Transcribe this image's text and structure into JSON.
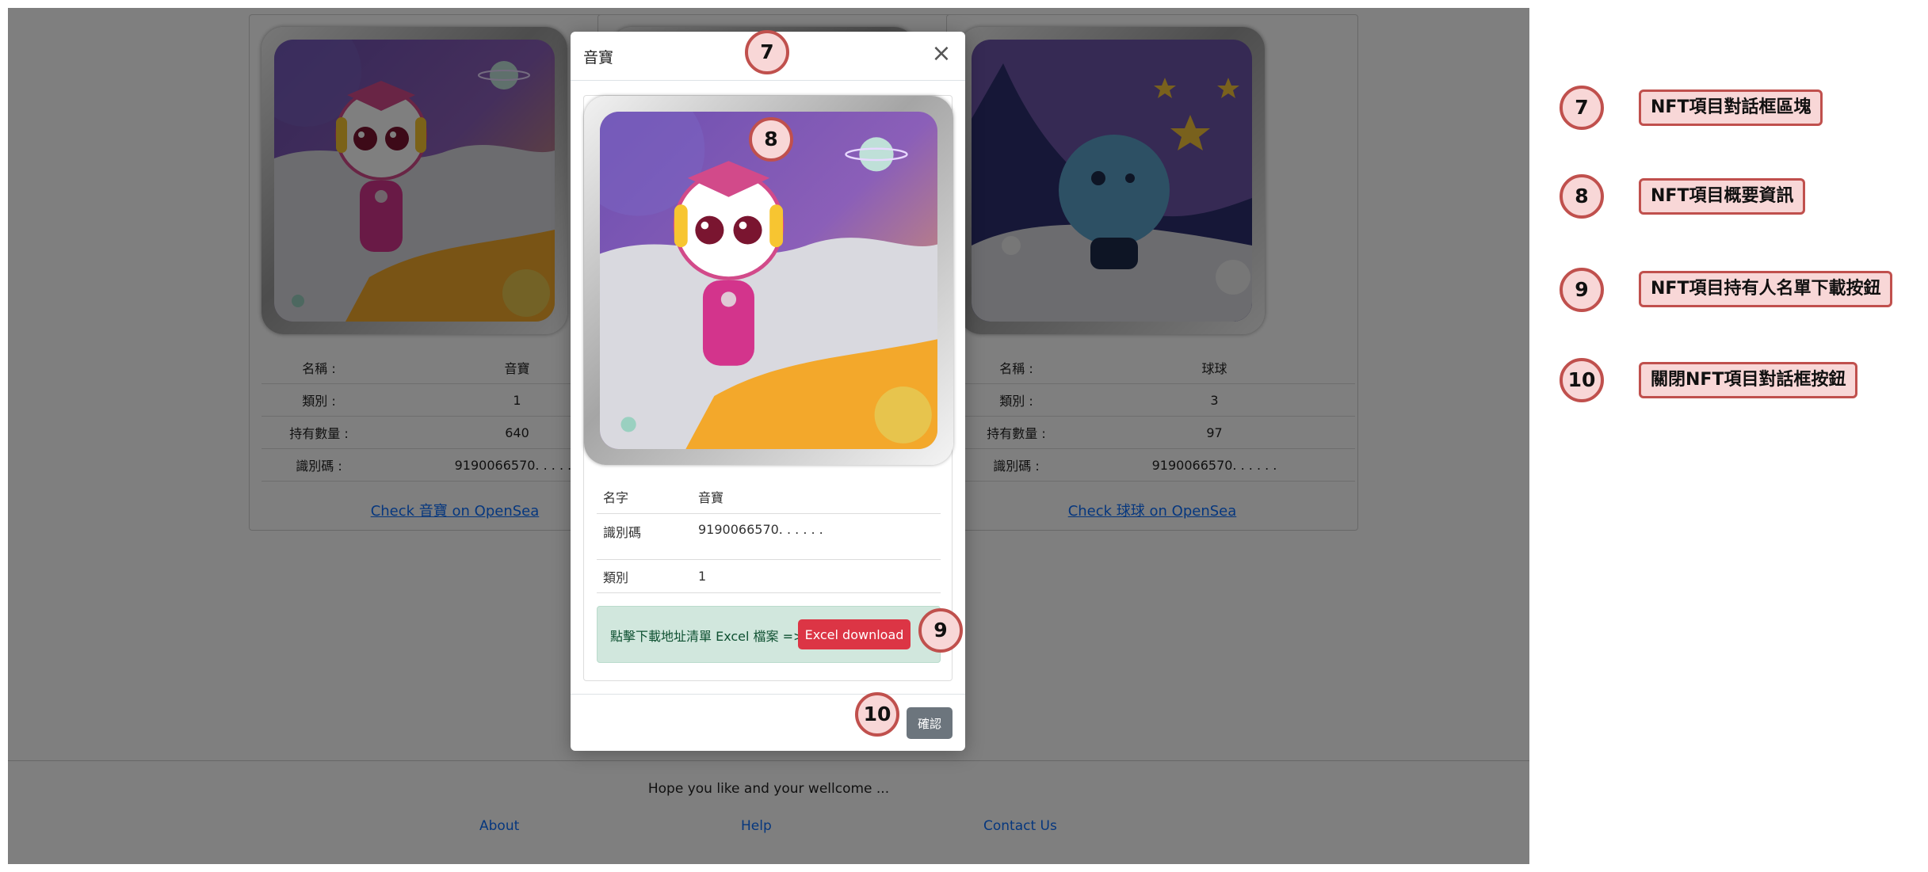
{
  "colors": {
    "accent": "#0d6efd",
    "danger": "#dc3545",
    "secondary": "#6c757d",
    "success_bg": "#d1e7dd",
    "annotation": "#c0504d"
  },
  "cards": [
    {
      "rows": [
        {
          "key": "名稱 :",
          "value": "音寶"
        },
        {
          "key": "類別 :",
          "value": "1"
        },
        {
          "key": "持有數量 :",
          "value": "640"
        },
        {
          "key": "識別碼 :",
          "value": "9190066570. . . . . ."
        }
      ],
      "link": "Check 音寶 on OpenSea"
    },
    {
      "rows": [
        {
          "key": "名稱 :",
          "value": ""
        },
        {
          "key": "類別 :",
          "value": ""
        },
        {
          "key": "持有數量 :",
          "value": ""
        },
        {
          "key": "識別碼 :",
          "value": ""
        }
      ],
      "link": ""
    },
    {
      "rows": [
        {
          "key": "名稱 :",
          "value": "球球"
        },
        {
          "key": "類別 :",
          "value": "3"
        },
        {
          "key": "持有數量 :",
          "value": "97"
        },
        {
          "key": "識別碼 :",
          "value": "9190066570. . . . . ."
        }
      ],
      "link": "Check 球球 on OpenSea"
    }
  ],
  "footer": {
    "text": "Hope you like and your wellcome ...",
    "links": [
      "About",
      "Help",
      "Contact Us"
    ]
  },
  "modal": {
    "title": "音寶",
    "close_icon": "close-icon",
    "info": [
      {
        "key": "名字",
        "value": "音寶"
      },
      {
        "key": "識別碼",
        "value": "9190066570. . . . . ."
      },
      {
        "key": "類別",
        "value": "1"
      }
    ],
    "alert_text": "點擊下載地址清單 Excel 檔案 =>",
    "excel_button": "Excel download",
    "confirm_button": "確認"
  },
  "markers": [
    "7",
    "8",
    "9",
    "10"
  ],
  "legend": [
    {
      "num": "7",
      "label": "NFT項目對話框區塊"
    },
    {
      "num": "8",
      "label": "NFT項目概要資訊"
    },
    {
      "num": "9",
      "label": "NFT項目持有人名單下載按鈕"
    },
    {
      "num": "10",
      "label": "關閉NFT項目對話框按鈕"
    }
  ]
}
